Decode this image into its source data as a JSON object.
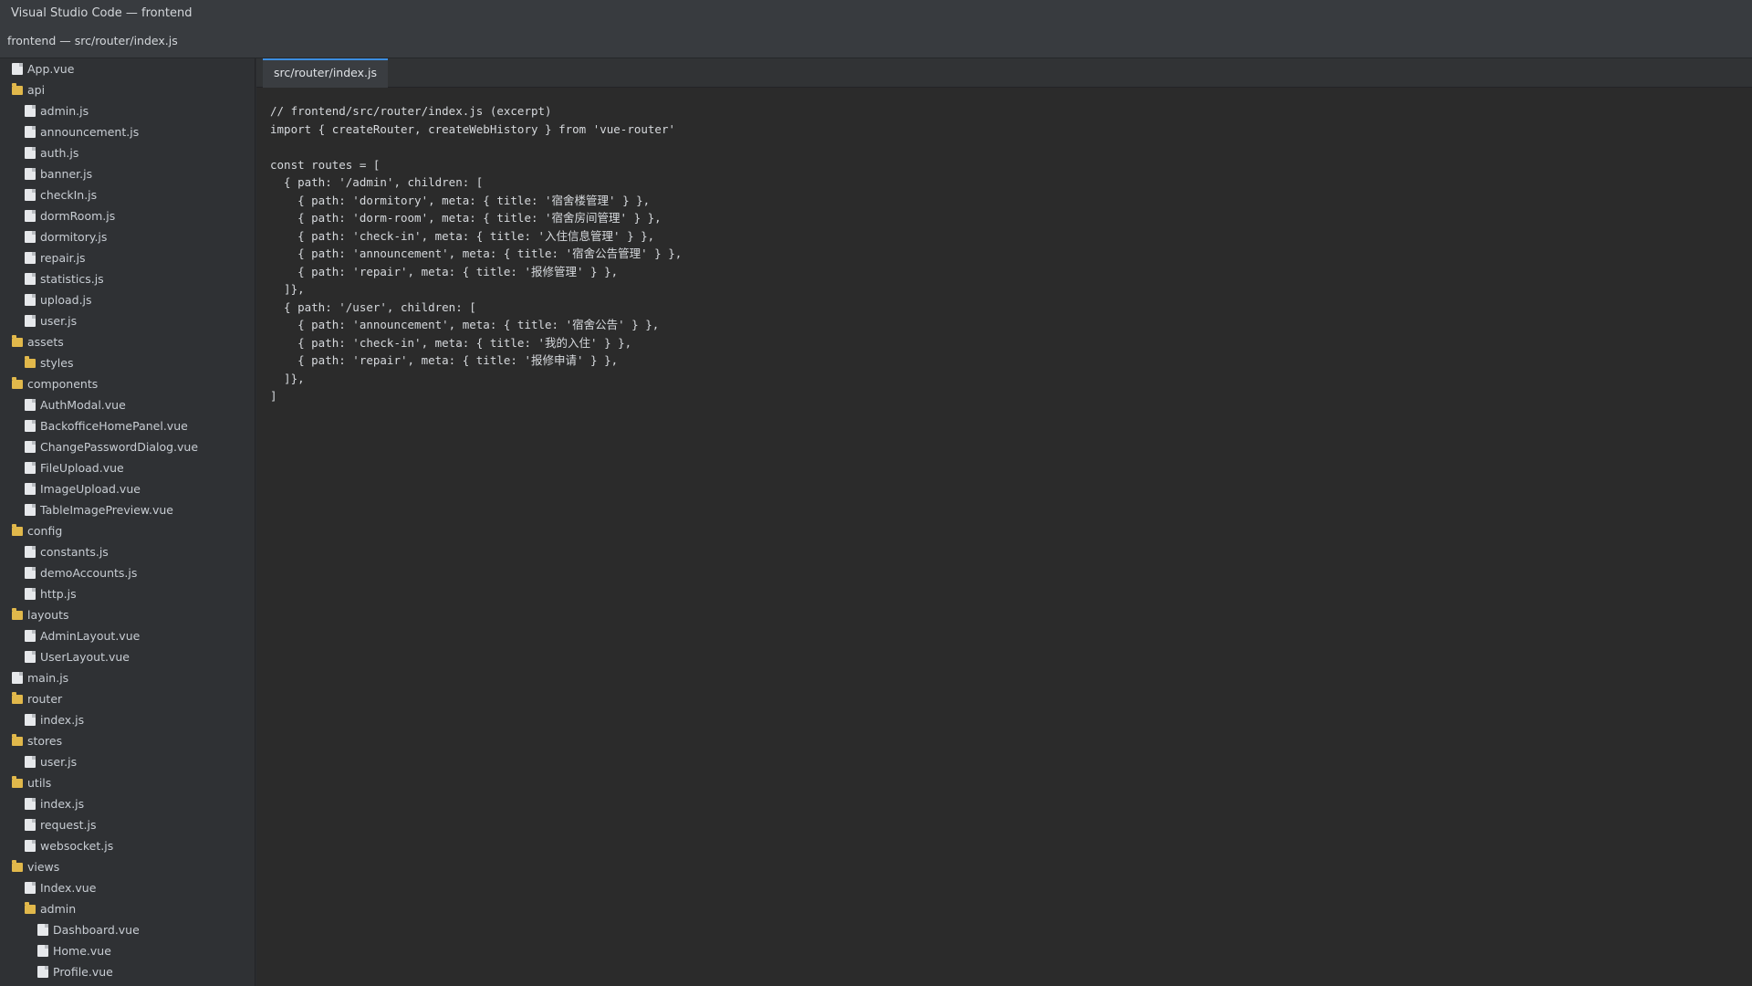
{
  "window": {
    "title": "Visual Studio Code — frontend"
  },
  "breadcrumb": {
    "text": "frontend — src/router/index.js"
  },
  "explorer": {
    "items": [
      {
        "name": "App.vue",
        "type": "file",
        "depth": 0
      },
      {
        "name": "api",
        "type": "folder",
        "depth": 0
      },
      {
        "name": "admin.js",
        "type": "file",
        "depth": 1
      },
      {
        "name": "announcement.js",
        "type": "file",
        "depth": 1
      },
      {
        "name": "auth.js",
        "type": "file",
        "depth": 1
      },
      {
        "name": "banner.js",
        "type": "file",
        "depth": 1
      },
      {
        "name": "checkIn.js",
        "type": "file",
        "depth": 1
      },
      {
        "name": "dormRoom.js",
        "type": "file",
        "depth": 1
      },
      {
        "name": "dormitory.js",
        "type": "file",
        "depth": 1
      },
      {
        "name": "repair.js",
        "type": "file",
        "depth": 1
      },
      {
        "name": "statistics.js",
        "type": "file",
        "depth": 1
      },
      {
        "name": "upload.js",
        "type": "file",
        "depth": 1
      },
      {
        "name": "user.js",
        "type": "file",
        "depth": 1
      },
      {
        "name": "assets",
        "type": "folder",
        "depth": 0
      },
      {
        "name": "styles",
        "type": "folder",
        "depth": 1
      },
      {
        "name": "components",
        "type": "folder",
        "depth": 0
      },
      {
        "name": "AuthModal.vue",
        "type": "file",
        "depth": 1
      },
      {
        "name": "BackofficeHomePanel.vue",
        "type": "file",
        "depth": 1
      },
      {
        "name": "ChangePasswordDialog.vue",
        "type": "file",
        "depth": 1
      },
      {
        "name": "FileUpload.vue",
        "type": "file",
        "depth": 1
      },
      {
        "name": "ImageUpload.vue",
        "type": "file",
        "depth": 1
      },
      {
        "name": "TableImagePreview.vue",
        "type": "file",
        "depth": 1
      },
      {
        "name": "config",
        "type": "folder",
        "depth": 0
      },
      {
        "name": "constants.js",
        "type": "file",
        "depth": 1
      },
      {
        "name": "demoAccounts.js",
        "type": "file",
        "depth": 1
      },
      {
        "name": "http.js",
        "type": "file",
        "depth": 1
      },
      {
        "name": "layouts",
        "type": "folder",
        "depth": 0
      },
      {
        "name": "AdminLayout.vue",
        "type": "file",
        "depth": 1
      },
      {
        "name": "UserLayout.vue",
        "type": "file",
        "depth": 1
      },
      {
        "name": "main.js",
        "type": "file",
        "depth": 0
      },
      {
        "name": "router",
        "type": "folder",
        "depth": 0
      },
      {
        "name": "index.js",
        "type": "file",
        "depth": 1
      },
      {
        "name": "stores",
        "type": "folder",
        "depth": 0
      },
      {
        "name": "user.js",
        "type": "file",
        "depth": 1
      },
      {
        "name": "utils",
        "type": "folder",
        "depth": 0
      },
      {
        "name": "index.js",
        "type": "file",
        "depth": 1
      },
      {
        "name": "request.js",
        "type": "file",
        "depth": 1
      },
      {
        "name": "websocket.js",
        "type": "file",
        "depth": 1
      },
      {
        "name": "views",
        "type": "folder",
        "depth": 0
      },
      {
        "name": "Index.vue",
        "type": "file",
        "depth": 1
      },
      {
        "name": "admin",
        "type": "folder",
        "depth": 1
      },
      {
        "name": "Dashboard.vue",
        "type": "file",
        "depth": 2
      },
      {
        "name": "Home.vue",
        "type": "file",
        "depth": 2
      },
      {
        "name": "Profile.vue",
        "type": "file",
        "depth": 2
      }
    ]
  },
  "editor": {
    "tabs": [
      {
        "label": "src/router/index.js"
      }
    ],
    "lines": [
      "// frontend/src/router/index.js (excerpt)",
      "import { createRouter, createWebHistory } from 'vue-router'",
      "",
      "const routes = [",
      "  { path: '/admin', children: [",
      "    { path: 'dormitory', meta: { title: '宿舍楼管理' } },",
      "    { path: 'dorm-room', meta: { title: '宿舍房间管理' } },",
      "    { path: 'check-in', meta: { title: '入住信息管理' } },",
      "    { path: 'announcement', meta: { title: '宿舍公告管理' } },",
      "    { path: 'repair', meta: { title: '报修管理' } },",
      "  ]},",
      "  { path: '/user', children: [",
      "    { path: 'announcement', meta: { title: '宿舍公告' } },",
      "    { path: 'check-in', meta: { title: '我的入住' } },",
      "    { path: 'repair', meta: { title: '报修申请' } },",
      "  ]},",
      "]"
    ]
  }
}
